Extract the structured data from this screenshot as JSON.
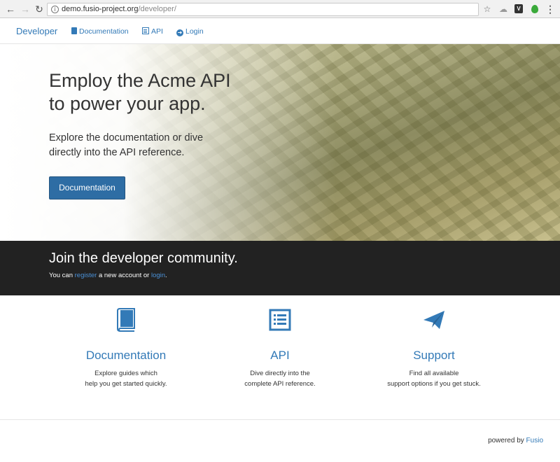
{
  "browser": {
    "url_host": "demo.fusio-project.org",
    "url_path": "/developer/",
    "icons": [
      "back-icon",
      "forward-icon",
      "reload-icon",
      "info-icon",
      "star-icon",
      "cloud-icon",
      "shield-icon",
      "leaf-icon",
      "menu-icon"
    ]
  },
  "navbar": {
    "brand": "Developer",
    "items": [
      {
        "label": "Documentation",
        "icon": "book-icon"
      },
      {
        "label": "API",
        "icon": "list-icon"
      },
      {
        "label": "Login",
        "icon": "login-icon"
      }
    ]
  },
  "hero": {
    "title_line1": "Employ the Acme API",
    "title_line2": "to power your app.",
    "subtitle_line1": "Explore the documentation or dive",
    "subtitle_line2": "directly into the API reference.",
    "button_label": "Documentation"
  },
  "community": {
    "title": "Join the developer community.",
    "text_prefix": "You can ",
    "register_link": "register",
    "text_middle": " a new account or ",
    "login_link": "login",
    "text_suffix": "."
  },
  "features": [
    {
      "title": "Documentation",
      "desc_line1": "Explore guides which",
      "desc_line2": "help you get started quickly.",
      "icon": "book-icon"
    },
    {
      "title": "API",
      "desc_line1": "Dive directly into the",
      "desc_line2": "complete API reference.",
      "icon": "list-icon"
    },
    {
      "title": "Support",
      "desc_line1": "Find all available",
      "desc_line2": "support options if you get stuck.",
      "icon": "paper-plane-icon"
    }
  ],
  "footer": {
    "prefix": "powered by ",
    "link": "Fusio"
  },
  "colors": {
    "link": "#337ab7",
    "button": "#2e6da4",
    "band": "#222222"
  }
}
